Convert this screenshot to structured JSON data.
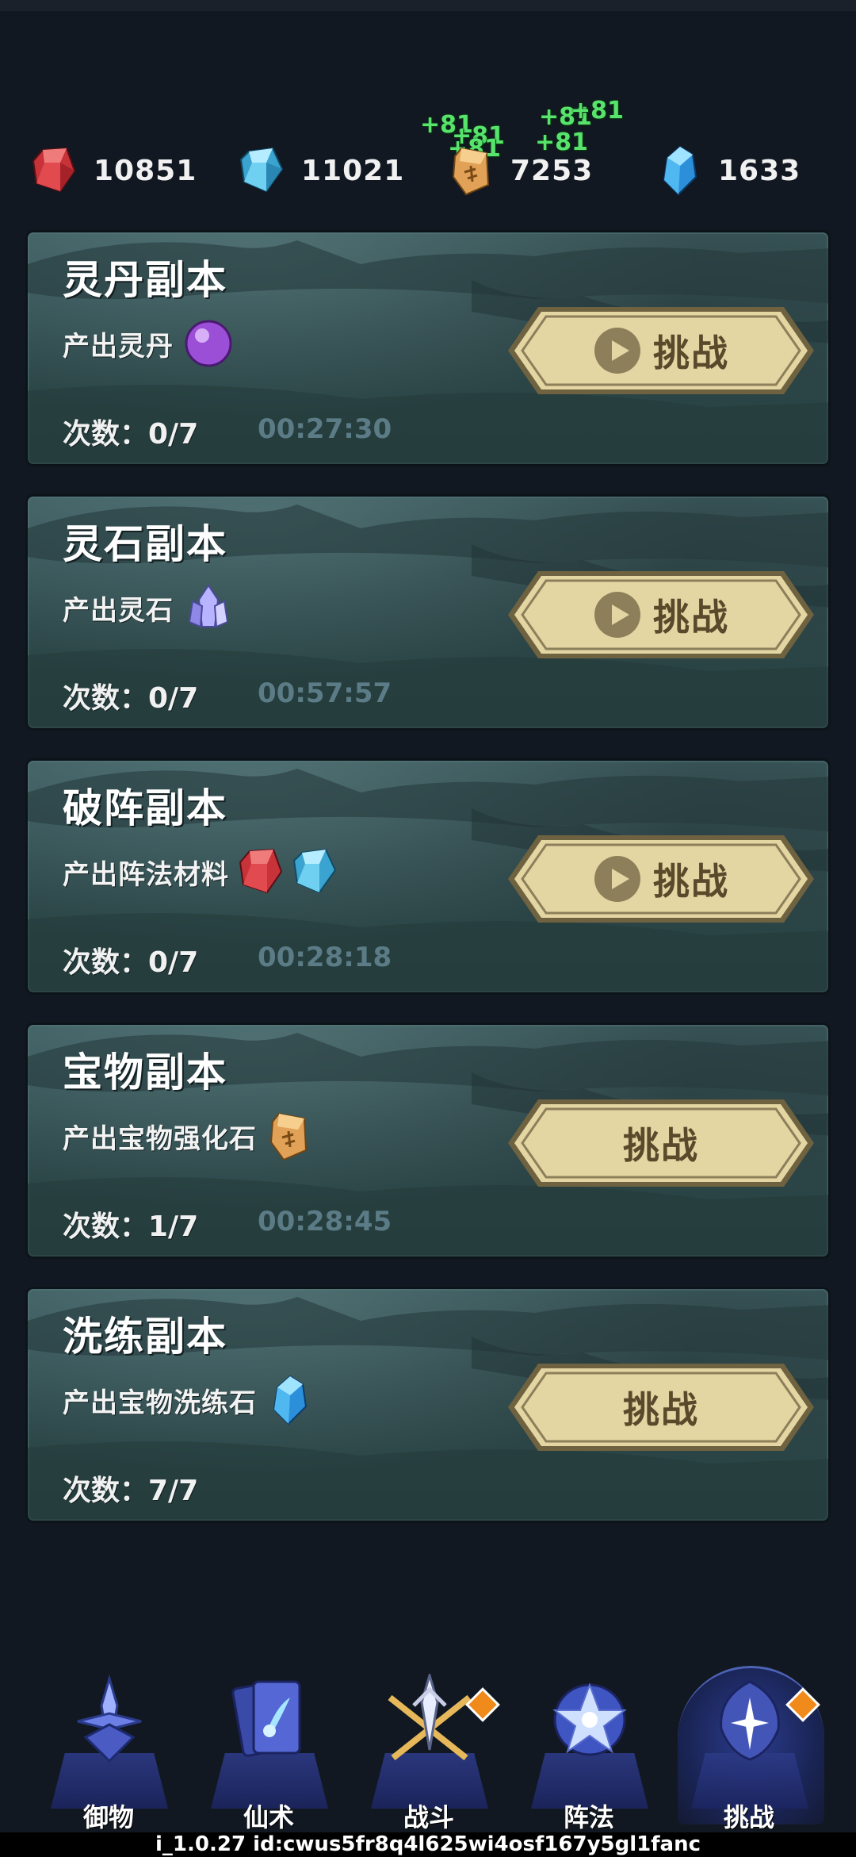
{
  "resources": [
    {
      "icon": "red-gem-icon",
      "value": "10851"
    },
    {
      "icon": "blue-gem-icon",
      "value": "11021"
    },
    {
      "icon": "rune-stone-icon",
      "value": "7253"
    },
    {
      "icon": "crystal-icon",
      "value": "1633"
    }
  ],
  "floating_gains": [
    "+81",
    "+81",
    "+81",
    "+81",
    "+81",
    "+81"
  ],
  "dungeons": [
    {
      "title": "灵丹副本",
      "output_label": "产出灵丹",
      "icon": "purple-pill-icon",
      "count": "次数：0/7",
      "timer": "00:27:30",
      "button": "挑战",
      "show_play": true
    },
    {
      "title": "灵石副本",
      "output_label": "产出灵石",
      "icon": "spirit-stone-icon",
      "count": "次数：0/7",
      "timer": "00:57:57",
      "button": "挑战",
      "show_play": true
    },
    {
      "title": "破阵副本",
      "output_label": "产出阵法材料",
      "icon": "red-gem-icon",
      "icon2": "blue-gem-icon",
      "count": "次数：0/7",
      "timer": "00:28:18",
      "button": "挑战",
      "show_play": true
    },
    {
      "title": "宝物副本",
      "output_label": "产出宝物强化石",
      "icon": "rune-stone-icon",
      "count": "次数：1/7",
      "timer": "00:28:45",
      "button": "挑战",
      "show_play": false
    },
    {
      "title": "洗练副本",
      "output_label": "产出宝物洗练石",
      "icon": "crystal-icon",
      "count": "次数：7/7",
      "timer": "",
      "button": "挑战",
      "show_play": false
    }
  ],
  "nav": [
    {
      "label": "御物",
      "icon": "sword-emblem-icon",
      "badge": false,
      "active": false
    },
    {
      "label": "仙术",
      "icon": "spell-card-icon",
      "badge": false,
      "active": false
    },
    {
      "label": "战斗",
      "icon": "crossed-weapons-icon",
      "badge": true,
      "active": false
    },
    {
      "label": "阵法",
      "icon": "formation-star-icon",
      "badge": false,
      "active": false
    },
    {
      "label": "挑战",
      "icon": "challenge-emblem-icon",
      "badge": true,
      "active": true
    }
  ],
  "version_text": "i_1.0.27 id:cwus5fr8q4l625wi4osf167y5gl1fanc",
  "colors": {
    "background": "#121821",
    "card": "#2f4a4d",
    "button_fill": "#e3d6a2",
    "button_text": "#5a4a2c",
    "timer_text": "#5b7c86",
    "gain_text": "#57e36c",
    "badge": "#f08a1a",
    "nav_plate": "#2c3a86"
  }
}
